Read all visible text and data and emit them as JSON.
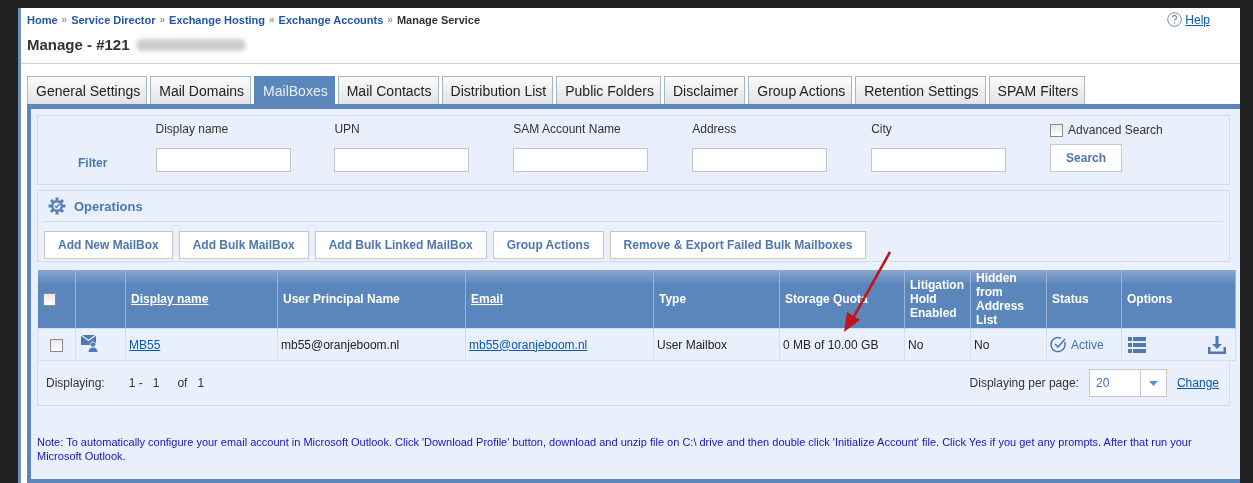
{
  "breadcrumb_separators": [
    "»",
    "»",
    "»",
    "»"
  ],
  "breadcrumb": [
    {
      "label": "Home",
      "link": true
    },
    {
      "label": "Service Director",
      "link": true
    },
    {
      "label": "Exchange Hosting",
      "link": true
    },
    {
      "label": "Exchange Accounts",
      "link": true
    },
    {
      "label": "Manage Service",
      "link": false
    }
  ],
  "help": "Help",
  "title": "Manage - #121",
  "tabs": [
    {
      "label": "General Settings",
      "selected": false
    },
    {
      "label": "Mail Domains",
      "selected": false
    },
    {
      "label": "MailBoxes",
      "selected": true
    },
    {
      "label": "Mail Contacts",
      "selected": false
    },
    {
      "label": "Distribution List",
      "selected": false
    },
    {
      "label": "Public Folders",
      "selected": false
    },
    {
      "label": "Disclaimer",
      "selected": false
    },
    {
      "label": "Group Actions",
      "selected": false
    },
    {
      "label": "Retention Settings",
      "selected": false
    },
    {
      "label": "SPAM Filters",
      "selected": false
    }
  ],
  "filter": {
    "label": "Filter",
    "fields": [
      {
        "label": "Display name"
      },
      {
        "label": "UPN"
      },
      {
        "label": "SAM Account Name"
      },
      {
        "label": "Address"
      },
      {
        "label": "City"
      }
    ],
    "advanced_search": {
      "label": "Advanced Search",
      "checked": false
    },
    "search_button": "Search"
  },
  "operations": {
    "title": "Operations",
    "buttons": [
      "Add New MailBox",
      "Add Bulk MailBox",
      "Add Bulk Linked MailBox",
      "Group Actions",
      "Remove & Export Failed Bulk Mailboxes"
    ]
  },
  "table": {
    "header_checked": false,
    "columns": [
      {
        "label": "Display name",
        "sortable": true
      },
      {
        "label": "User Principal Name",
        "sortable": false
      },
      {
        "label": "Email",
        "sortable": true
      },
      {
        "label": "Type",
        "sortable": false
      },
      {
        "label": "Storage Quota",
        "sortable": false
      },
      {
        "label": "Litigation Hold Enabled",
        "sortable": false
      },
      {
        "label": "Hidden from Address List",
        "sortable": false
      },
      {
        "label": "Status",
        "sortable": false
      },
      {
        "label": "Options",
        "sortable": false
      }
    ],
    "rows": [
      {
        "checked": false,
        "display_name": "MB55",
        "upn": "mb55@oranjeboom.nl",
        "email": "mb55@oranjeboom.nl",
        "type": "User Mailbox",
        "storage_quota": "0 MB of 10.00 GB",
        "litigation_hold": "No",
        "hidden": "No",
        "status": "Active"
      }
    ]
  },
  "pager": {
    "label": "Displaying:",
    "from": "1 -",
    "to": "1",
    "of": "of",
    "total": "1",
    "per_page_label": "Displaying per page:",
    "per_page": "20",
    "change": "Change"
  },
  "note": "Note: To automatically configure your email account in Microsoft Outlook. Click 'Download Profile' button, download and unzip file on C:\\ drive and then double click 'Initialize Account' file. Click Yes if you get any prompts. After that run your Microsoft Outlook."
}
